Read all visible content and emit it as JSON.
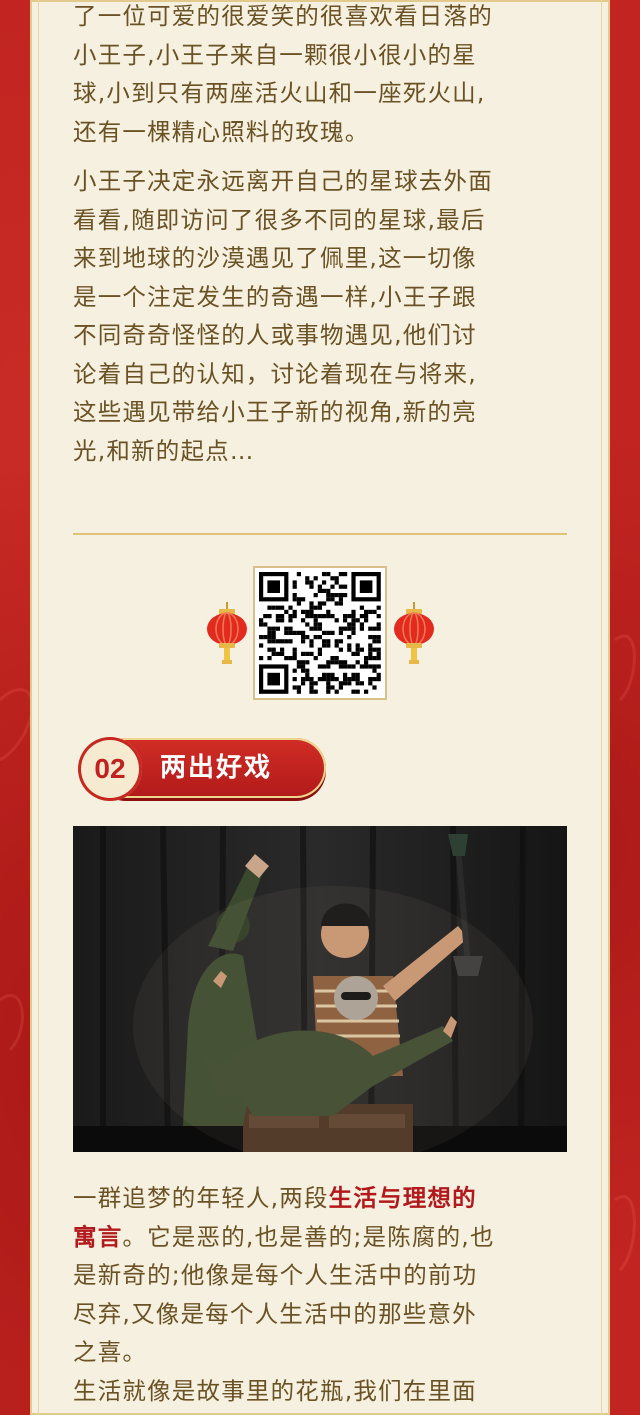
{
  "article": {
    "para1_lines": [
      "了一位可爱的很爱笑的很喜欢看日落的",
      "小王子,小王子来自一颗很小很小的星",
      "球,小到只有两座活火山和一座死火山,",
      "还有一棵精心照料的玫瑰。"
    ],
    "para2_lines": [
      "小王子决定永远离开自己的星球去外面",
      "看看,随即访问了很多不同的星球,最后",
      "来到地球的沙漠遇见了佩里,这一切像",
      "是一个注定发生的奇遇一样,小王子跟",
      "不同奇奇怪怪的人或事物遇见,他们讨",
      "论着自己的认知，讨论着现在与将来,",
      "这些遇见带给小王子新的视角,新的亮",
      "光,和新的起点…"
    ]
  },
  "qr": {
    "icon": "qr-code-icon"
  },
  "section2": {
    "number": "02",
    "title": "两出好戏"
  },
  "photo": {
    "icon": "stage-performance-photo"
  },
  "description": {
    "line1_prefix": "一群追梦的年轻人,两段",
    "highlight_1": "生活与理想的",
    "highlight_2": "寓言",
    "line2_suffix": "。它是恶的,也是善的;是陈腐的,也",
    "lines_rest": [
      "是新奇的;他像是每个人生活中的前功",
      "尽弃,又像是每个人生活中的那些意外",
      "之喜。"
    ],
    "para_next_line": "生活就像是故事里的花瓶,我们在里面"
  },
  "colors": {
    "background_red": "#c22521",
    "paper": "#f5f0e0",
    "text_brown": "#6b5224",
    "accent_red": "#b3191c",
    "gold": "#e0c37a"
  }
}
